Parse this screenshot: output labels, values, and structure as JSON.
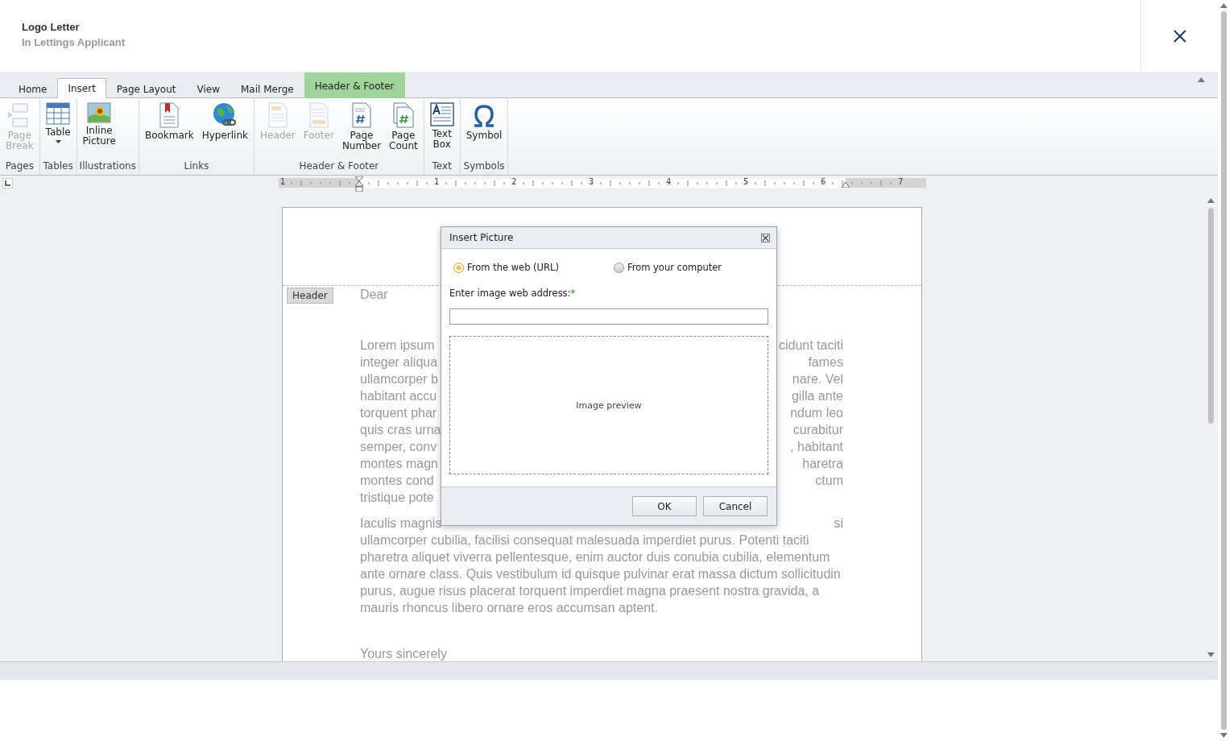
{
  "header": {
    "title": "Logo Letter",
    "subtitle": "In Lettings Applicant"
  },
  "tabs": [
    {
      "label": "Home",
      "selected": false,
      "contextual": false
    },
    {
      "label": "Insert",
      "selected": true,
      "contextual": false
    },
    {
      "label": "Page Layout",
      "selected": false,
      "contextual": false
    },
    {
      "label": "View",
      "selected": false,
      "contextual": false
    },
    {
      "label": "Mail Merge",
      "selected": false,
      "contextual": false
    },
    {
      "label": "Header & Footer",
      "selected": false,
      "contextual": true
    }
  ],
  "ribbon": [
    {
      "label": "Pages",
      "buttons": [
        {
          "kind": "pagebreak",
          "label": "Page Break",
          "disabled": true
        }
      ]
    },
    {
      "label": "Tables",
      "buttons": [
        {
          "kind": "table",
          "label": "Table",
          "disabled": false,
          "dropdown": true
        }
      ]
    },
    {
      "label": "Illustrations",
      "buttons": [
        {
          "kind": "picture",
          "label": "Inline Picture",
          "disabled": false
        }
      ]
    },
    {
      "label": "Links",
      "buttons": [
        {
          "kind": "bookmark",
          "label": "Bookmark",
          "disabled": false
        },
        {
          "kind": "hyperlink",
          "label": "Hyperlink",
          "disabled": false
        }
      ]
    },
    {
      "label": "Header & Footer",
      "buttons": [
        {
          "kind": "header",
          "label": "Header",
          "disabled": true
        },
        {
          "kind": "footer",
          "label": "Footer",
          "disabled": true
        },
        {
          "kind": "pagenumber",
          "label": "Page Number",
          "disabled": false
        },
        {
          "kind": "pagecount",
          "label": "Page Count",
          "disabled": false
        }
      ]
    },
    {
      "label": "Text",
      "buttons": [
        {
          "kind": "textbox",
          "label": "Text Box",
          "disabled": false
        }
      ]
    },
    {
      "label": "Symbols",
      "buttons": [
        {
          "kind": "symbol",
          "label": "Symbol",
          "disabled": false
        }
      ]
    }
  ],
  "ruler": [
    "1",
    "1",
    "2",
    "3",
    "4",
    "5",
    "6",
    "7"
  ],
  "document": {
    "header_tag": "Header",
    "greeting": "Dear",
    "paragraphs": [
      [
        {
          "left": "Lorem ipsum",
          "right": "cidunt taciti"
        },
        {
          "left": "integer aliqua",
          "right": "fames"
        },
        {
          "left": "ullamcorper b",
          "right": "nare. Vel"
        },
        {
          "left": "habitant accu",
          "right": "gilla ante"
        },
        {
          "left": "torquent phar",
          "right": "ndum leo"
        },
        {
          "left": "quis cras urna",
          "right": "curabitur"
        },
        {
          "left": "semper, conv",
          "right": ", habitant"
        },
        {
          "left": "montes magn",
          "right": "haretra"
        },
        {
          "left": "montes cond",
          "right": "ctum"
        },
        {
          "left": "tristique pote"
        }
      ],
      [
        {
          "left": "Iaculis magnis",
          "right": "si"
        },
        {
          "left": "ullamcorper cubilia, facilisi consequat malesuada imperdiet purus. Potenti taciti"
        },
        {
          "left": "pharetra aliquet viverra pellentesque, enim auctor duis conubia cubilia, elementum"
        },
        {
          "left": "ante ornare class. Quis vestibulum id quisque pulvinar erat massa dictum sollicitudin"
        },
        {
          "left": "purus, augue risus placerat torquent imperdiet magna praesent nostra gravida, a"
        },
        {
          "left": "mauris rhoncus libero ornare eros accumsan aptent."
        }
      ]
    ],
    "closing": "Yours sincerely"
  },
  "dialog": {
    "title": "Insert Picture",
    "options": [
      {
        "label": "From the web (URL)",
        "selected": true
      },
      {
        "label": "From your computer",
        "selected": false
      }
    ],
    "field_label": "Enter image web address:",
    "required_mark": "*",
    "preview": "Image preview",
    "buttons": [
      "OK",
      "Cancel"
    ]
  }
}
